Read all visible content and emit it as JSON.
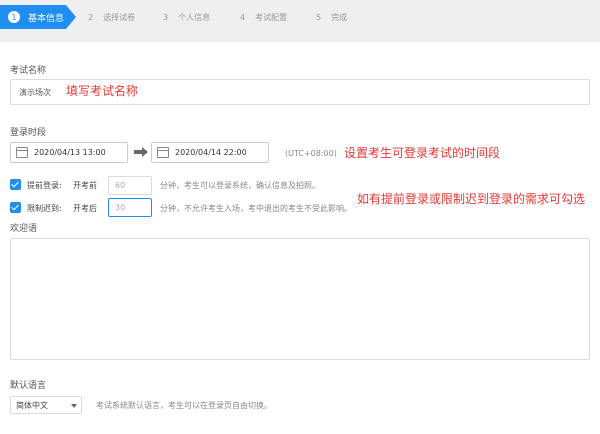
{
  "steps": [
    {
      "num": "1",
      "label": "基本信息",
      "active": true
    },
    {
      "num": "2",
      "label": "选择试卷"
    },
    {
      "num": "3",
      "label": "个人信息"
    },
    {
      "num": "4",
      "label": "考试配置"
    },
    {
      "num": "5",
      "label": "完成"
    }
  ],
  "exam_name": {
    "label": "考试名称",
    "value": "演示场次",
    "annotation": "填写考试名称"
  },
  "login_time": {
    "label": "登录时段",
    "start": "2020/04/13 13:00",
    "end": "2020/04/14 22:00",
    "timezone": "(UTC+08:00)",
    "annotation": "设置考生可登录考试的时间段"
  },
  "early_login": {
    "label": "提前登录:",
    "prefix": "开考前",
    "value": "60",
    "suffix": "分钟，考生可以登录系统，确认信息及拍照。"
  },
  "late_limit": {
    "label": "限制迟到:",
    "prefix": "开考后",
    "value": "30",
    "suffix": "分钟，不允许考生入场，考中退出的考生不受此影响。"
  },
  "checkbox_annotation": "如有提前登录或限制迟到登录的需求可勾选",
  "welcome": {
    "label": "欢迎语"
  },
  "language": {
    "label": "默认语言",
    "selected": "简体中文",
    "hint": "考试系统默认语言，考生可以在登录页自由切换。"
  },
  "colors": {
    "accent": "#1f8ef0",
    "annotation": "#e53935"
  }
}
